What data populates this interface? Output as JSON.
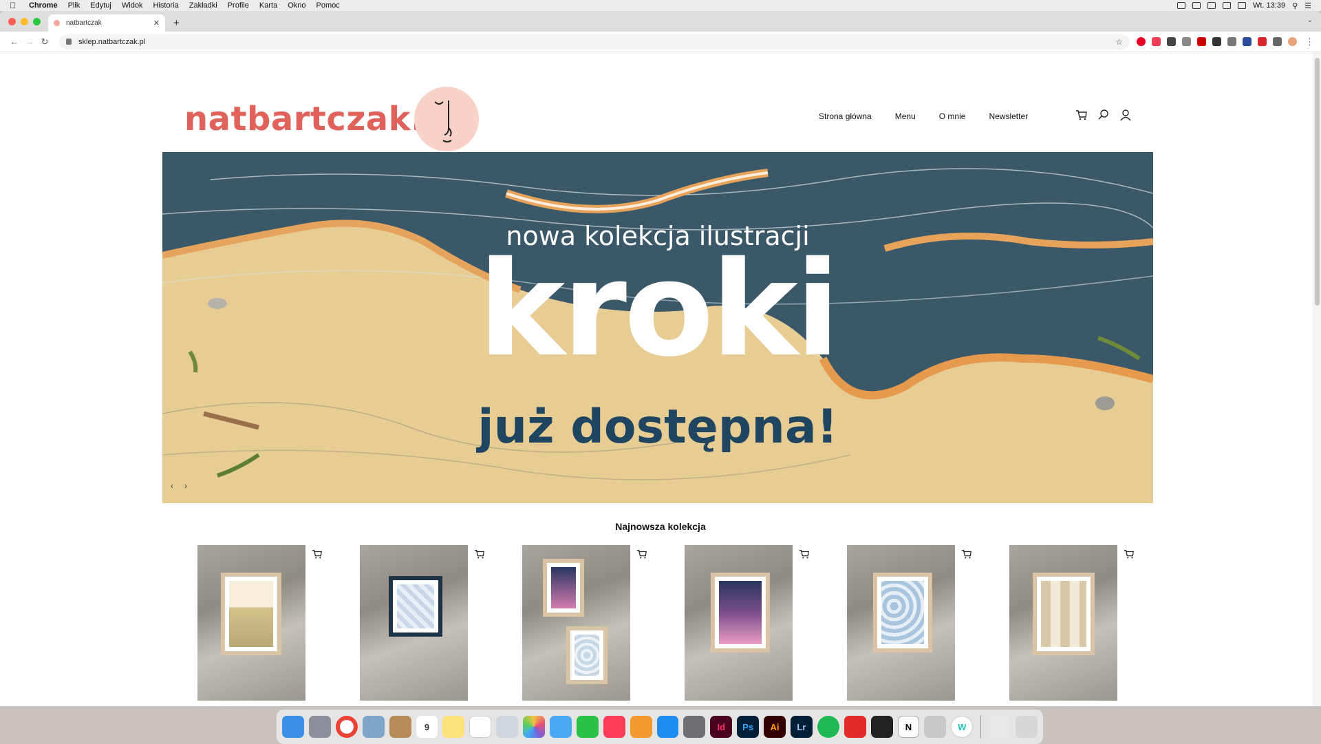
{
  "menubar": {
    "app_name": "Chrome",
    "items": [
      "Plik",
      "Edytuj",
      "Widok",
      "Historia",
      "Zakładki",
      "Profile",
      "Karta",
      "Okno",
      "Pomoc"
    ],
    "clock": "Wt. 13:39"
  },
  "browser": {
    "tab_title": "natbartczak",
    "url": "sklep.natbartczak.pl"
  },
  "site": {
    "logo_text": "natbartczak.",
    "brand_color": "#e0625a",
    "nav": [
      "Strona główna",
      "Menu",
      "O mnie",
      "Newsletter"
    ],
    "nav_icons": [
      "cart-icon",
      "search-icon",
      "user-icon"
    ]
  },
  "hero": {
    "subtitle": "nowa kolekcja ilustracji",
    "title": "kroki",
    "tagline": "już dostępna!",
    "prev_label": "‹",
    "next_label": "›"
  },
  "collection": {
    "heading": "Najnowsza kolekcja",
    "products": [
      {
        "art": "flowers-vase"
      },
      {
        "art": "blue-checker"
      },
      {
        "art": "pink-clouds-pair"
      },
      {
        "art": "pink-clouds"
      },
      {
        "art": "blue-stones"
      },
      {
        "art": "giraffes"
      }
    ]
  },
  "dock": {
    "apps": [
      "Finder",
      "Launchpad",
      "Chrome",
      "Preview",
      "Contacts",
      "Calendar",
      "Notes",
      "Reminders",
      "Image Capture",
      "Photos",
      "Messages",
      "FaceTime",
      "Music",
      "Books",
      "App Store",
      "System Preferences",
      "InDesign",
      "Photoshop",
      "Illustrator",
      "Lightroom",
      "Spotify",
      "Acrobat Reader",
      "Kindle",
      "Notion",
      "Acrobat",
      "Wunderlist",
      "Files",
      "Trash"
    ],
    "calendar_day": "9"
  }
}
